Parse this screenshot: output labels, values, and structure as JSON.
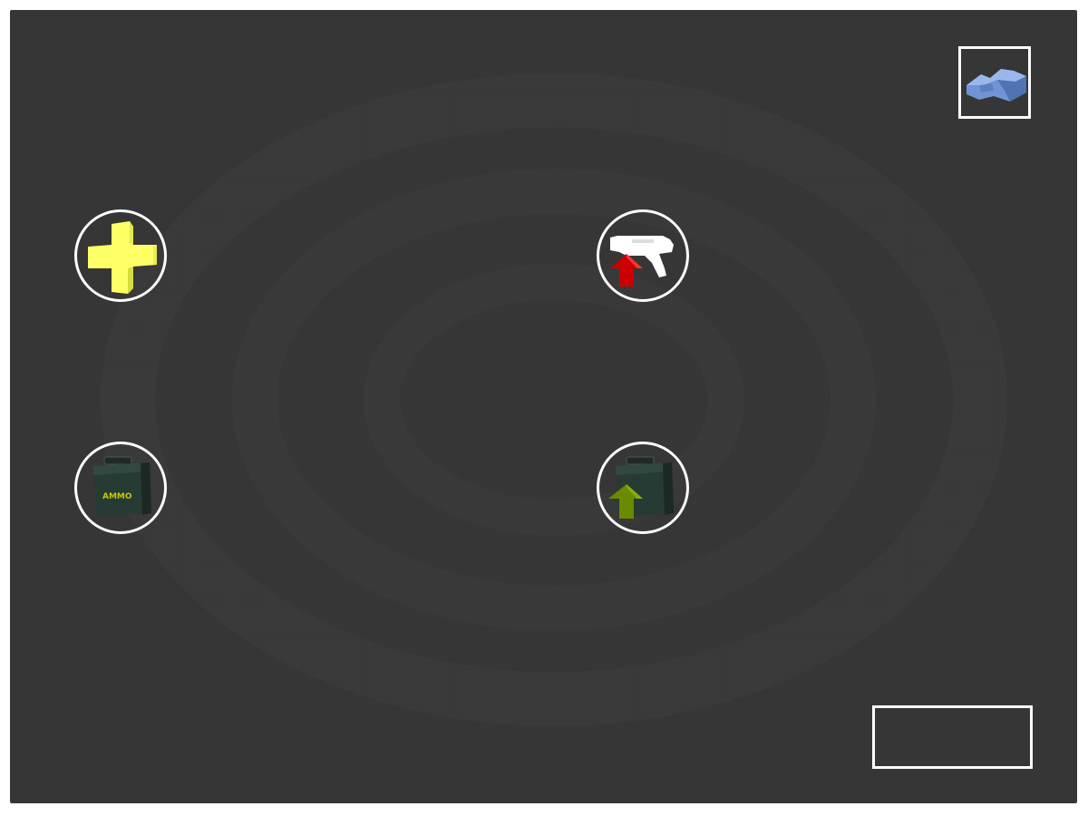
{
  "screen": {
    "background_color": "#363636",
    "border_color": "#ffffff"
  },
  "items": [
    {
      "id": "health",
      "icon": "health-cross-icon",
      "color": "#ffff66"
    },
    {
      "id": "weapon_upgrade",
      "icon": "blaster-gun-with-up-arrow-icon",
      "arrow_color": "#cc0000"
    },
    {
      "id": "ammo",
      "icon": "ammo-box-icon",
      "box_label": "AMMO",
      "label_color": "#c8c800"
    },
    {
      "id": "ammo_upgrade",
      "icon": "ammo-box-with-up-arrow-icon",
      "arrow_color": "#6a8a00"
    }
  ],
  "map_button": {
    "icon": "map-terrain-icon",
    "color": "#6f95d6"
  },
  "action_button": {
    "label": ""
  }
}
